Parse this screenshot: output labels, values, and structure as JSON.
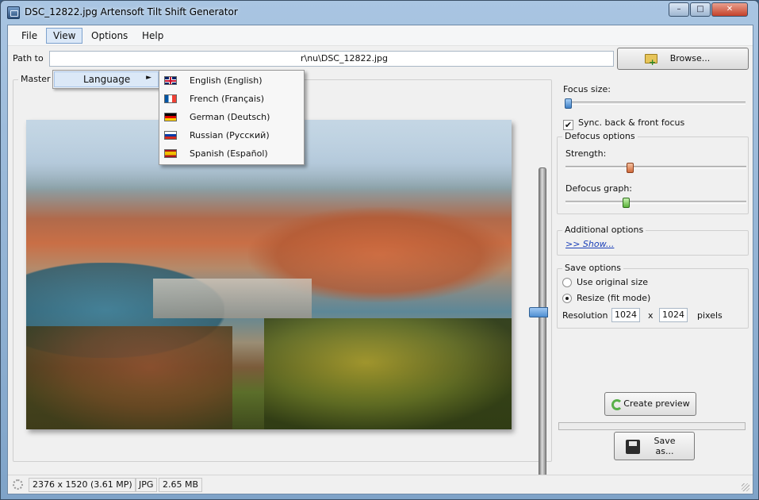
{
  "window": {
    "title": "DSC_12822.jpg Artensoft Tilt Shift Generator",
    "controls": {
      "minimize": "–",
      "maximize": "□",
      "close": "✕"
    }
  },
  "menubar": {
    "items": [
      {
        "label": "File"
      },
      {
        "label": "View"
      },
      {
        "label": "Options"
      },
      {
        "label": "Help"
      }
    ],
    "open_menu": "View"
  },
  "view_menu": {
    "items": [
      {
        "label": "Language",
        "submenu_arrow": "►"
      }
    ],
    "language_submenu": [
      {
        "label": "English (English)",
        "flag": "gb-flag-icon"
      },
      {
        "label": "French (Français)",
        "flag": "fr-flag-icon"
      },
      {
        "label": "German (Deutsch)",
        "flag": "de-flag-icon"
      },
      {
        "label": "Russian (Русский)",
        "flag": "ru-flag-icon"
      },
      {
        "label": "Spanish (Español)",
        "flag": "es-flag-icon"
      }
    ]
  },
  "path": {
    "label": "Path to",
    "value": "r\\nu\\DSC_12822.jpg",
    "browse_label": "Browse..."
  },
  "preview": {
    "group_title": "Master image preview",
    "focus_position_fraction": 0.45
  },
  "focus": {
    "label": "Focus size:",
    "value_fraction": 0.0,
    "sync_label": "Sync. back & front focus",
    "sync_checked": true
  },
  "defocus": {
    "group_title": "Defocus options",
    "strength_label": "Strength:",
    "strength_fraction": 0.35,
    "graph_label": "Defocus graph:",
    "graph_fraction": 0.33
  },
  "additional": {
    "group_title": "Additional options",
    "show_link": ">> Show..."
  },
  "save_options": {
    "group_title": "Save options",
    "use_original_label": "Use original size",
    "resize_label": "Resize (fit mode)",
    "selected": "resize",
    "resolution_label": "Resolution",
    "width": "1024",
    "times": "x",
    "height": "1024",
    "unit": "pixels"
  },
  "actions": {
    "create_preview": "Create preview",
    "save_as_line1": "Save",
    "save_as_line2": "as..."
  },
  "status": {
    "dimensions": "2376 x 1520 (3.61 MP)",
    "format": "JPG",
    "size": "2.65 MB"
  },
  "colors": {
    "accent": "#4f8fd2",
    "link": "#1a3fb8",
    "menu_highlight": "#dbe8f7"
  }
}
